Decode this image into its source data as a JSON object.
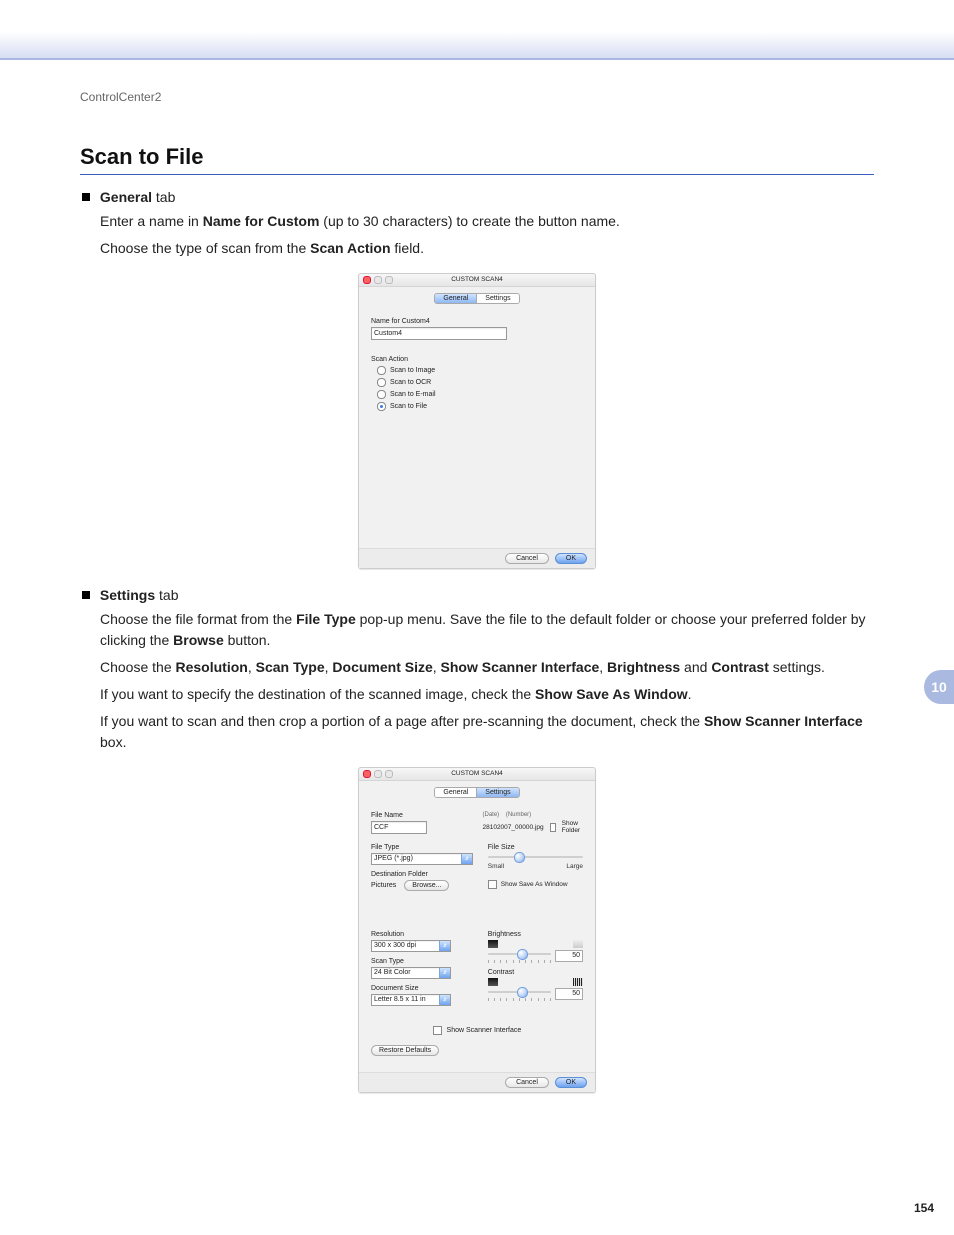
{
  "header": {
    "breadcrumb": "ControlCenter2"
  },
  "title": "Scan to File",
  "page_number": "154",
  "chapter_tab": "10",
  "sections": {
    "general": {
      "heading_bold": "General",
      "heading_rest": " tab",
      "p1_a": "Enter a name in ",
      "p1_b": "Name for Custom",
      "p1_c": " (up to 30 characters) to create the button name.",
      "p2_a": "Choose the type of scan from the ",
      "p2_b": "Scan Action",
      "p2_c": " field."
    },
    "settings": {
      "heading_bold": "Settings",
      "heading_rest": " tab",
      "p1_a": "Choose the file format from the ",
      "p1_b": "File Type",
      "p1_c": " pop-up menu. Save the file to the default folder or choose your preferred folder by clicking the ",
      "p1_d": "Browse",
      "p1_e": " button.",
      "p2_a": "Choose the ",
      "p2_b": "Resolution",
      "p2_c": ", ",
      "p2_d": "Scan Type",
      "p2_e": ", ",
      "p2_f": "Document Size",
      "p2_g": ", ",
      "p2_h": "Show Scanner Interface",
      "p2_i": ", ",
      "p2_j": "Brightness",
      "p2_k": " and ",
      "p2_l": "Contrast",
      "p2_m": " settings.",
      "p3_a": "If you want to specify the destination of the scanned image, check the ",
      "p3_b": "Show Save As Window",
      "p3_c": ".",
      "p4_a": "If you want to scan and then crop a portion of a page after pre-scanning the document, check the ",
      "p4_b": "Show Scanner Interface",
      "p4_c": " box."
    }
  },
  "dlg1": {
    "title": "CUSTOM SCAN4",
    "tab_general": "General",
    "tab_settings": "Settings",
    "name_label": "Name for Custom4",
    "name_value": "Custom4",
    "action_label": "Scan Action",
    "opt_image": "Scan to Image",
    "opt_ocr": "Scan to OCR",
    "opt_email": "Scan to E-mail",
    "opt_file": "Scan to File",
    "cancel": "Cancel",
    "ok": "OK"
  },
  "dlg2": {
    "title": "CUSTOM SCAN4",
    "tab_general": "General",
    "tab_settings": "Settings",
    "file_name_label": "File Name",
    "file_name_value": "CCF",
    "date_hint": "(Date)",
    "number_hint": "(Number)",
    "sample_name": "28102007_00000.jpg",
    "show_folder": "Show Folder",
    "file_type_label": "File Type",
    "file_type_value": "JPEG (*.jpg)",
    "file_size_label": "File Size",
    "size_small": "Small",
    "size_large": "Large",
    "dest_label": "Destination Folder",
    "dest_value": "Pictures",
    "browse": "Browse...",
    "show_save_as": "Show Save As Window",
    "resolution_label": "Resolution",
    "resolution_value": "300 x 300 dpi",
    "scan_type_label": "Scan Type",
    "scan_type_value": "24 Bit Color",
    "doc_size_label": "Document Size",
    "doc_size_value": "Letter  8.5 x 11 in",
    "brightness_label": "Brightness",
    "contrast_label": "Contrast",
    "brightness_value": "50",
    "contrast_value": "50",
    "show_scanner_interface": "Show Scanner Interface",
    "restore_defaults": "Restore Defaults",
    "cancel": "Cancel",
    "ok": "OK"
  }
}
